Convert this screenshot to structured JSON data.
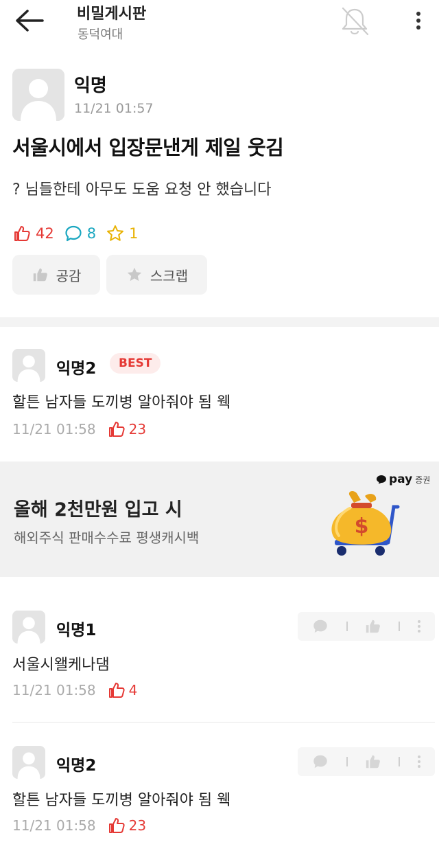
{
  "header": {
    "title": "비밀게시판",
    "subtitle": "동덕여대"
  },
  "post": {
    "author": "익명",
    "time": "11/21 01:57",
    "title": "서울시에서 입장문낸게 제일 웃김",
    "body": "? 님들한테 아무도 도움 요청 안 했습니다",
    "likes": "42",
    "comments": "8",
    "scraps": "1",
    "like_button": "공감",
    "scrap_button": "스크랩"
  },
  "best_comment": {
    "author": "익명2",
    "badge": "BEST",
    "body": "할튼 남자들 도끼병 알아줘야 됨 웩",
    "time": "11/21 01:58",
    "likes": "23"
  },
  "ad": {
    "brand_pay": "pay",
    "brand_sec": "증권",
    "headline": "올해 2천만원 입고 시",
    "subline": "해외주식 판매수수료 평생캐시백"
  },
  "comments": [
    {
      "author": "익명1",
      "body": "서울시왤케나댐",
      "time": "11/21 01:58",
      "likes": "4"
    },
    {
      "author": "익명2",
      "body": "할튼 남자들 도끼병 알아줘야 됨 웩",
      "time": "11/21 01:58",
      "likes": "23"
    }
  ],
  "colors": {
    "accent_red": "#e53935",
    "comment_teal": "#1aa7c0",
    "scrap_yellow": "#e8b100"
  }
}
